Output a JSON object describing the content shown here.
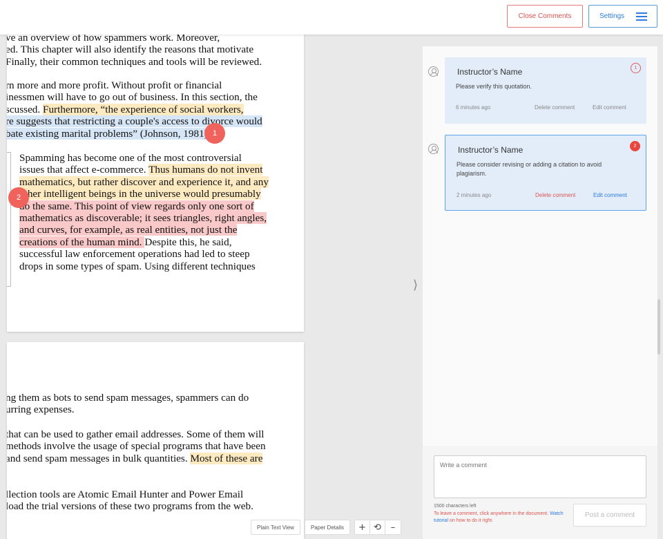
{
  "header": {
    "close_comments": "Close Comments",
    "settings": "Settings"
  },
  "document": {
    "page1_lines": [
      "ve an overview of how spammers work. Moreover,",
      "ed. This chapter will also identify the reasons that motivate",
      "Finally, their common techniques and tools will be reviewed.",
      "",
      "rn more and more profit. Without profit or financial",
      "inessmen will have to go out of business. In this section, the",
      "scussed. ",
      "Furthermore, “the experience of social workers,",
      "re suggests that restricting a couple's access to divorce would",
      "bate existing marital problems” (Johnson, 1981)."
    ],
    "quote_lines": [
      "Spamming has become one of the most controversial",
      "issues that affect e-commerce. ",
      "Thus humans do not invent",
      "mathematics, but rather discover and experience it, and any",
      "other intelligent beings in the universe would presumably",
      "do the same. This point of view regards only one sort of",
      "mathematics as discoverable; it sees triangles, right angles,",
      "and curves, for example, as real entities, not just the",
      "creations of the human mind. ",
      "Despite this, he said,",
      "successful law enforcement operations had led to steep",
      "drops in some types of spam. Using different techniques"
    ],
    "page2_lines": [
      "ng them as bots to send spam messages, spammers can do",
      "urring expenses.",
      "",
      " that can be used to gather email addresses. Some of them will",
      "methods involve the usage of special programs that have been",
      " and send spam messages in bulk quantities. ",
      "Most of these are",
      "",
      "llection tools are Atomic Email Hunter and Power Email",
      "load the trial versions of these two programs from the web."
    ]
  },
  "markers": [
    "1",
    "2"
  ],
  "comments": [
    {
      "author": "Instructor’s Name",
      "text": "Please verify this quotation.",
      "time": "6 minutes ago",
      "delete": "Delete comment",
      "edit": "Edit comment",
      "badge": "1"
    },
    {
      "author": "Instructor’s Name",
      "text": "Please consider revising or adding a citation to avoid plagiarism.",
      "time": "2 minutes ago",
      "delete": "Delete comment",
      "edit": "Edit comment",
      "badge": "2"
    }
  ],
  "composer": {
    "placeholder": "Write a comment",
    "chars_left": "1500 characters left",
    "hint_prefix": "To leave a comment, click anywhere in the document. ",
    "hint_link": "Watch tutorial",
    "hint_suffix": " on how to do it right.",
    "post_button": "Post a comment"
  },
  "toolbar": {
    "plain_text_view": "Plain Text View",
    "paper_details": "Paper Details",
    "zoom_in": "+",
    "reset": "⟲",
    "zoom_out": "–"
  },
  "panel_toggle": "⟩",
  "colors": {
    "highlight_yellow": "#fdeac1",
    "highlight_blue": "#d6e6f6",
    "highlight_red": "#f9c8c8",
    "marker": "#f0625c",
    "accent_blue": "#2c7be5",
    "accent_red": "#d9534f"
  }
}
